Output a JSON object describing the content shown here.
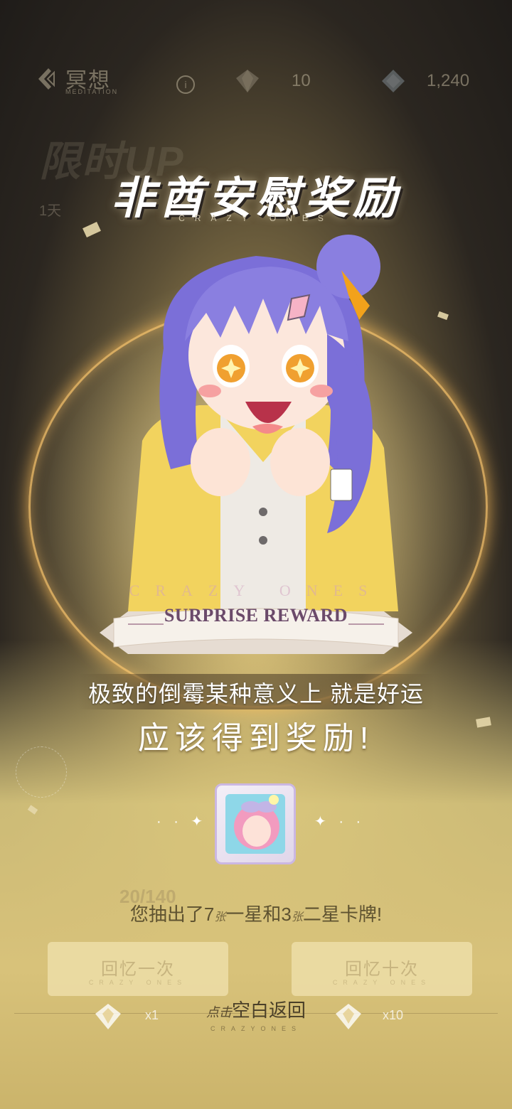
{
  "topbar": {
    "title": "冥想",
    "subtitle": "MEDITATION",
    "info_icon": "i",
    "currency1_value": "10",
    "currency2_value": "1,240"
  },
  "background": {
    "banner": "限时UP",
    "timer": "1天"
  },
  "header": {
    "title": "非酋安慰奖励",
    "subtitle": "CRAZY ONES"
  },
  "ribbon": {
    "label": "SURPRISE REWARD",
    "ghost": "CRAZY ONES"
  },
  "message": {
    "line1": "极致的倒霉某种意义上 就是好运",
    "line2": "应该得到奖励!"
  },
  "result": {
    "prefix": "您抽出了7",
    "unit": "张",
    "middle": "一星和3",
    "suffix": "二星卡牌!"
  },
  "progress_ghost": "20/140",
  "buttons": {
    "draw_one": {
      "label": "回忆一次",
      "sub": "CRAZY ONES",
      "cost": "x1"
    },
    "draw_ten": {
      "label": "回忆十次",
      "sub": "CRAZY ONES",
      "cost": "x10"
    }
  },
  "footer": {
    "tap_hand": "点击",
    "tap_label": "空白返回",
    "tap_sub": "CRAZYONES"
  },
  "colors": {
    "accent_gold": "#d8c27a",
    "ribbon_text": "#6b4a6a",
    "hair_purple": "#8a7fe0"
  }
}
